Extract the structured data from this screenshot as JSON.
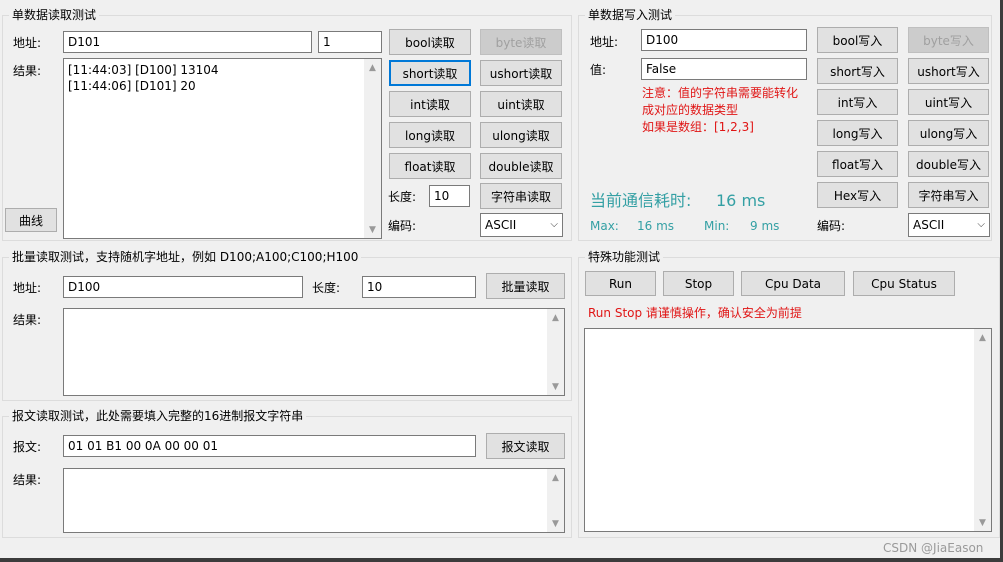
{
  "single_read": {
    "title": "单数据读取测试",
    "address_label": "地址:",
    "address_value": "D101",
    "count_value": "1",
    "result_label": "结果:",
    "results": [
      "[11:44:03] [D100] 13104",
      "[11:44:06] [D101] 20"
    ],
    "curve_button": "曲线",
    "buttons": {
      "bool": "bool读取",
      "byte": "byte读取",
      "short": "short读取",
      "ushort": "ushort读取",
      "int": "int读取",
      "uint": "uint读取",
      "long": "long读取",
      "ulong": "ulong读取",
      "float": "float读取",
      "double": "double读取",
      "string": "字符串读取"
    },
    "length_label": "长度:",
    "length_value": "10",
    "encoding_label": "编码:",
    "encoding_value": "ASCII"
  },
  "single_write": {
    "title": "单数据写入测试",
    "address_label": "地址:",
    "address_value": "D100",
    "value_label": "值:",
    "value_value": "False",
    "note_lines": [
      "注意：值的字符串需要能转化",
      "成对应的数据类型",
      "如果是数组：[1,2,3]"
    ],
    "comm_time_label": "当前通信耗时:",
    "comm_time_value": "16 ms",
    "max_label": "Max:",
    "max_value": "16 ms",
    "min_label": "Min:",
    "min_value": "9 ms",
    "buttons": {
      "bool": "bool写入",
      "byte": "byte写入",
      "short": "short写入",
      "ushort": "ushort写入",
      "int": "int写入",
      "uint": "uint写入",
      "long": "long写入",
      "ulong": "ulong写入",
      "float": "float写入",
      "double": "double写入",
      "hex": "Hex写入",
      "string": "字符串写入"
    },
    "encoding_label": "编码:",
    "encoding_value": "ASCII"
  },
  "batch_read": {
    "title": "批量读取测试，支持随机字地址，例如 D100;A100;C100;H100",
    "address_label": "地址:",
    "address_value": "D100",
    "length_label": "长度:",
    "length_value": "10",
    "button": "批量读取",
    "result_label": "结果:"
  },
  "message_read": {
    "title": "报文读取测试，此处需要填入完整的16进制报文字符串",
    "message_label": "报文:",
    "message_value": "01 01 B1 00 0A 00 00 01",
    "button": "报文读取",
    "result_label": "结果:"
  },
  "special": {
    "title": "特殊功能测试",
    "buttons": {
      "run": "Run",
      "stop": "Stop",
      "cpu_data": "Cpu Data",
      "cpu_status": "Cpu Status"
    },
    "warning": "Run Stop 请谨慎操作，确认安全为前提"
  },
  "watermark": "CSDN @JiaEason",
  "colors": {
    "warning": "#e01515",
    "stats": "#34a0a4",
    "focus": "#0078d7"
  }
}
